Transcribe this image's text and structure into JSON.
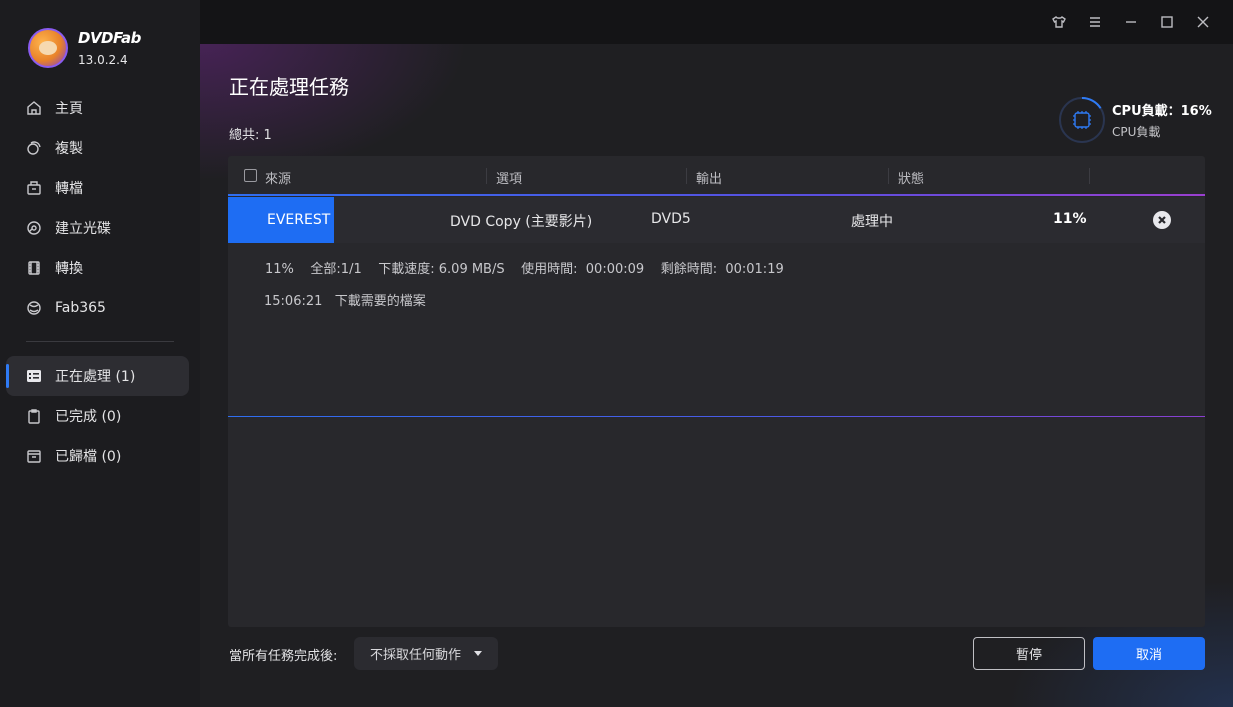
{
  "app": {
    "brand": "DVDFab",
    "version": "13.0.2.4"
  },
  "sidebar": {
    "items": [
      {
        "label": "主頁",
        "icon": "home-icon"
      },
      {
        "label": "複製",
        "icon": "copy-icon"
      },
      {
        "label": "轉檔",
        "icon": "ripper-icon"
      },
      {
        "label": "建立光碟",
        "icon": "disc-icon"
      },
      {
        "label": "轉換",
        "icon": "film-icon"
      },
      {
        "label": "Fab365",
        "icon": "fab365-icon"
      }
    ],
    "queue": [
      {
        "label": "正在處理 (1)",
        "icon": "task-list-icon",
        "active": true
      },
      {
        "label": "已完成 (0)",
        "icon": "clipboard-icon"
      },
      {
        "label": "已歸檔 (0)",
        "icon": "archive-icon"
      }
    ]
  },
  "header": {
    "title": "正在處理任務",
    "total": "總共: 1"
  },
  "cpu": {
    "main_label": "CPU負載：16%",
    "sub_label": "CPU負載",
    "load_fraction": 0.16
  },
  "table": {
    "columns": [
      "來源",
      "選項",
      "輸出",
      "狀態"
    ],
    "rows": [
      {
        "source": "EVEREST",
        "option": "DVD Copy (主要影片)",
        "output": "DVD5",
        "status": "處理中",
        "progress": "11%"
      }
    ],
    "detail": {
      "stats": "11%    全部:1/1    下載速度: 6.09 MB/S    使用時間:  00:00:09    剩餘時間:  00:01:19",
      "log": "15:06:21   下載需要的檔案"
    }
  },
  "footer": {
    "after_label": "當所有任務完成後:",
    "after_value": "不採取任何動作",
    "pause_label": "暫停",
    "cancel_label": "取消"
  },
  "colors": {
    "accent": "#1e6df3",
    "sidebar_bg": "#1c1c1f",
    "panel_bg": "#28282c"
  }
}
